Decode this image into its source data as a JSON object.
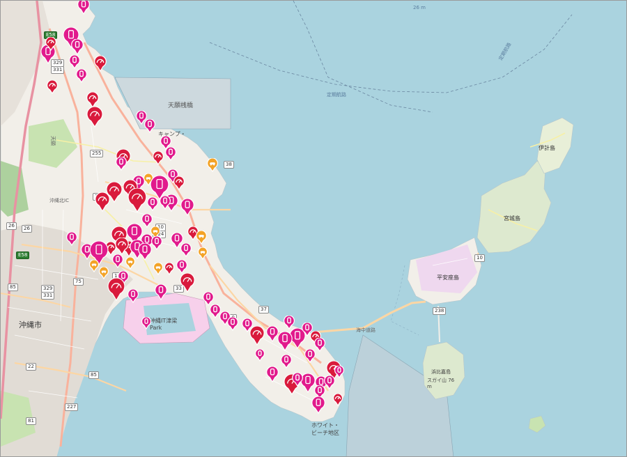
{
  "map": {
    "labels": {
      "tenganbashi": "天願桟橋",
      "camp": "キャンプ・",
      "okinawashi": "沖縄市",
      "heianzajima": "平安座島",
      "miyagijima": "宮城島",
      "ikeijima": "伊計島",
      "hamahigajima": "浜比嘉島",
      "whitebeach": "ホワイト・ビーチ地区",
      "okinawa_port": "沖縄IT津梁Park",
      "kaichu_road": "海中道路",
      "seaway_a": "定期航路",
      "seaway_b": "定期航路",
      "depth": "26 m",
      "okinawa_kita": "沖縄北IC",
      "kitaba": "天願",
      "hamahiga_peak": "スガイ山 76 m"
    },
    "route_shields": [
      "E58",
      "E58",
      "329",
      "331",
      "329",
      "331",
      "255",
      "26",
      "36",
      "10",
      "224",
      "85",
      "16",
      "75",
      "85",
      "227",
      "81",
      "22",
      "33",
      "38",
      "10",
      "37",
      "238",
      "10",
      "26"
    ],
    "marker_types": {
      "phone": "phone-marker-icon",
      "gauge": "gauge-marker-icon",
      "car": "car-marker-icon"
    },
    "colors": {
      "sea": "#aad3df",
      "land": "#f2efe9",
      "urban": "#e1dcd5",
      "green": "#c8e3b1",
      "phone": "#e11a8c",
      "gauge": "#d91a3c",
      "car": "#f3a327",
      "highway": "#e892a2",
      "trunk": "#f9b29c",
      "primary": "#fcd6a4",
      "restricted": "#f7d0eb"
    }
  }
}
